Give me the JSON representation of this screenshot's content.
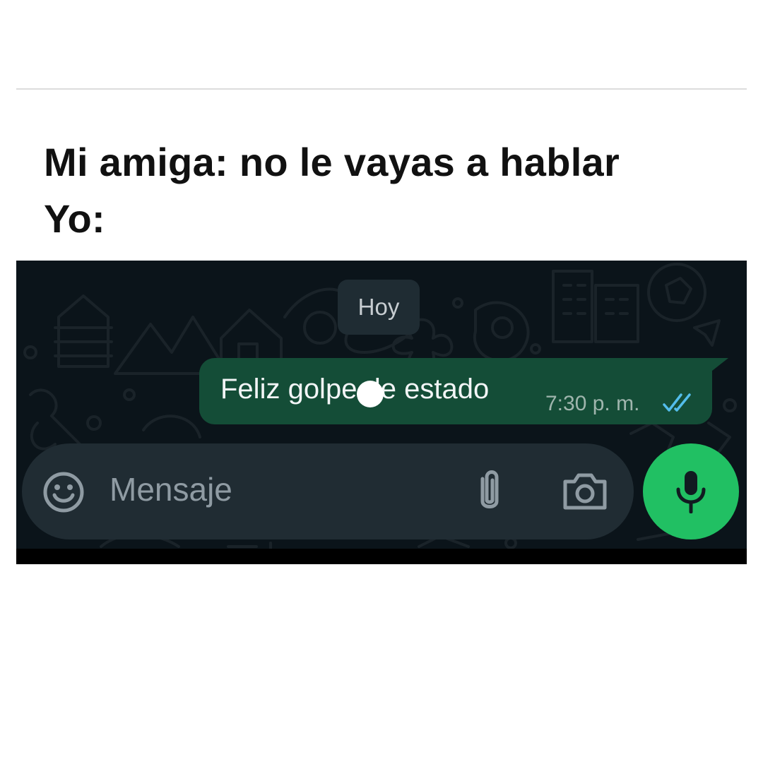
{
  "caption": {
    "line1": "Mi amiga: no le vayas a hablar",
    "line2": "Yo:"
  },
  "chat": {
    "date_chip": "Hoy",
    "message": {
      "text": "Feliz golpe de estado",
      "time": "7:30 p. m.",
      "status_icon": "double-check-read-icon"
    },
    "input": {
      "placeholder": "Mensaje",
      "left_icon": "emoji-icon",
      "attach_icon": "paperclip-icon",
      "camera_icon": "camera-icon"
    },
    "send_button_icon": "microphone-icon"
  },
  "colors": {
    "chat_background": "#0b141a",
    "outgoing_bubble": "#144d37",
    "input_bar": "#202c33",
    "mic_button": "#21c063",
    "read_ticks": "#53bdeb"
  }
}
